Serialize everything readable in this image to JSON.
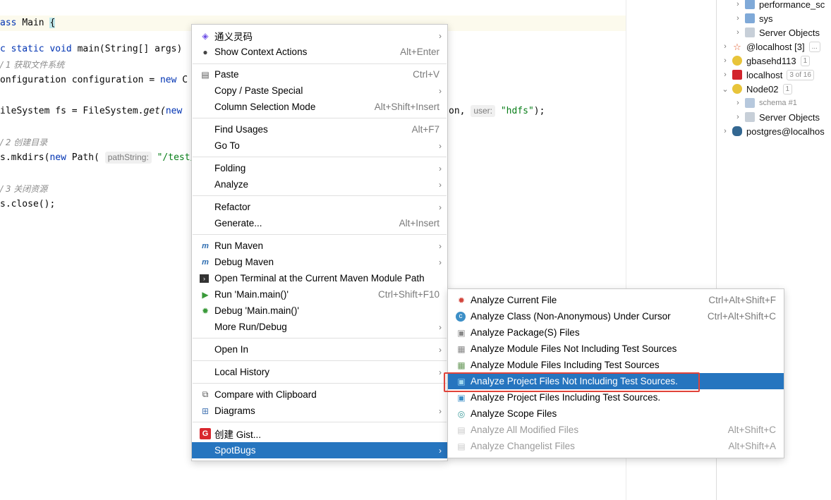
{
  "editor": {
    "lines": {
      "l1": [
        "ass",
        "Main",
        "{"
      ],
      "l2": [
        "c",
        "static",
        "void",
        "main(String[] args)"
      ],
      "l3": "/ 1 获取文件系统",
      "l4": [
        "onfiguration configuration = ",
        "new",
        " C"
      ],
      "l5": [
        "ileSystem fs = FileSystem.",
        "get(",
        "new"
      ],
      "l5b": [
        "on,",
        "user:",
        "\"hdfs\"",
        ");"
      ],
      "l6": "/ 2 创建目录",
      "l7": [
        "s.mkdirs(",
        "new",
        " Path(",
        "pathString:",
        "\"/test/"
      ],
      "l8": "/ 3 关闭资源",
      "l9": "s.close();"
    }
  },
  "db_tree": [
    {
      "label": "performance_sc"
    },
    {
      "label": "sys"
    },
    {
      "label": "Server Objects"
    },
    {
      "label": "@localhost [3]",
      "badge": "..."
    },
    {
      "label": "gbasehd113",
      "badge": "1"
    },
    {
      "label": "localhost",
      "badge": "3 of 16"
    },
    {
      "label": "Node02",
      "badge": "1"
    },
    {
      "label": "schema #1"
    },
    {
      "label": "Server Objects"
    },
    {
      "label": "postgres@localhos"
    }
  ],
  "context_menu": [
    {
      "label": "通义灵码",
      "arrow": true,
      "icon": "tongyi-icon"
    },
    {
      "label": "Show Context Actions",
      "shortcut": "Alt+Enter",
      "icon": "bulb-icon"
    },
    {
      "label": "Paste",
      "shortcut": "Ctrl+V",
      "icon": "paste-icon"
    },
    {
      "label": "Copy / Paste Special",
      "arrow": true
    },
    {
      "label": "Column Selection Mode",
      "shortcut": "Alt+Shift+Insert"
    },
    {
      "label": "Find Usages",
      "shortcut": "Alt+F7"
    },
    {
      "label": "Go To",
      "arrow": true
    },
    {
      "label": "Folding",
      "arrow": true
    },
    {
      "label": "Analyze",
      "arrow": true
    },
    {
      "label": "Refactor",
      "arrow": true
    },
    {
      "label": "Generate...",
      "shortcut": "Alt+Insert"
    },
    {
      "label": "Run Maven",
      "arrow": true,
      "icon": "maven-run-icon"
    },
    {
      "label": "Debug Maven",
      "arrow": true,
      "icon": "maven-debug-icon"
    },
    {
      "label": "Open Terminal at the Current Maven Module Path",
      "icon": "terminal-icon"
    },
    {
      "label": "Run 'Main.main()'",
      "shortcut": "Ctrl+Shift+F10",
      "icon": "run-icon"
    },
    {
      "label": "Debug 'Main.main()'",
      "icon": "debug-icon"
    },
    {
      "label": "More Run/Debug",
      "arrow": true
    },
    {
      "label": "Open In",
      "arrow": true
    },
    {
      "label": "Local History",
      "arrow": true
    },
    {
      "label": "Compare with Clipboard",
      "icon": "compare-icon"
    },
    {
      "label": "Diagrams",
      "arrow": true,
      "icon": "diagram-icon"
    },
    {
      "label": "创建 Gist...",
      "icon": "gist-icon"
    },
    {
      "label": "SpotBugs",
      "arrow": true
    }
  ],
  "submenu": [
    {
      "label": "Analyze Current File",
      "shortcut": "Ctrl+Alt+Shift+F"
    },
    {
      "label": "Analyze Class (Non-Anonymous) Under Cursor",
      "shortcut": "Ctrl+Alt+Shift+C"
    },
    {
      "label": "Analyze Package(S) Files"
    },
    {
      "label": "Analyze Module Files Not Including Test Sources"
    },
    {
      "label": "Analyze Module Files Including Test Sources"
    },
    {
      "label": "Analyze Project Files Not Including Test Sources."
    },
    {
      "label": "Analyze Project Files Including Test Sources."
    },
    {
      "label": "Analyze Scope Files"
    },
    {
      "label": "Analyze All Modified Files",
      "shortcut": "Alt+Shift+C"
    },
    {
      "label": "Analyze Changelist Files",
      "shortcut": "Alt+Shift+A"
    }
  ],
  "colors": {
    "selection": "#2675bf",
    "highlight_box": "#e0433a"
  }
}
